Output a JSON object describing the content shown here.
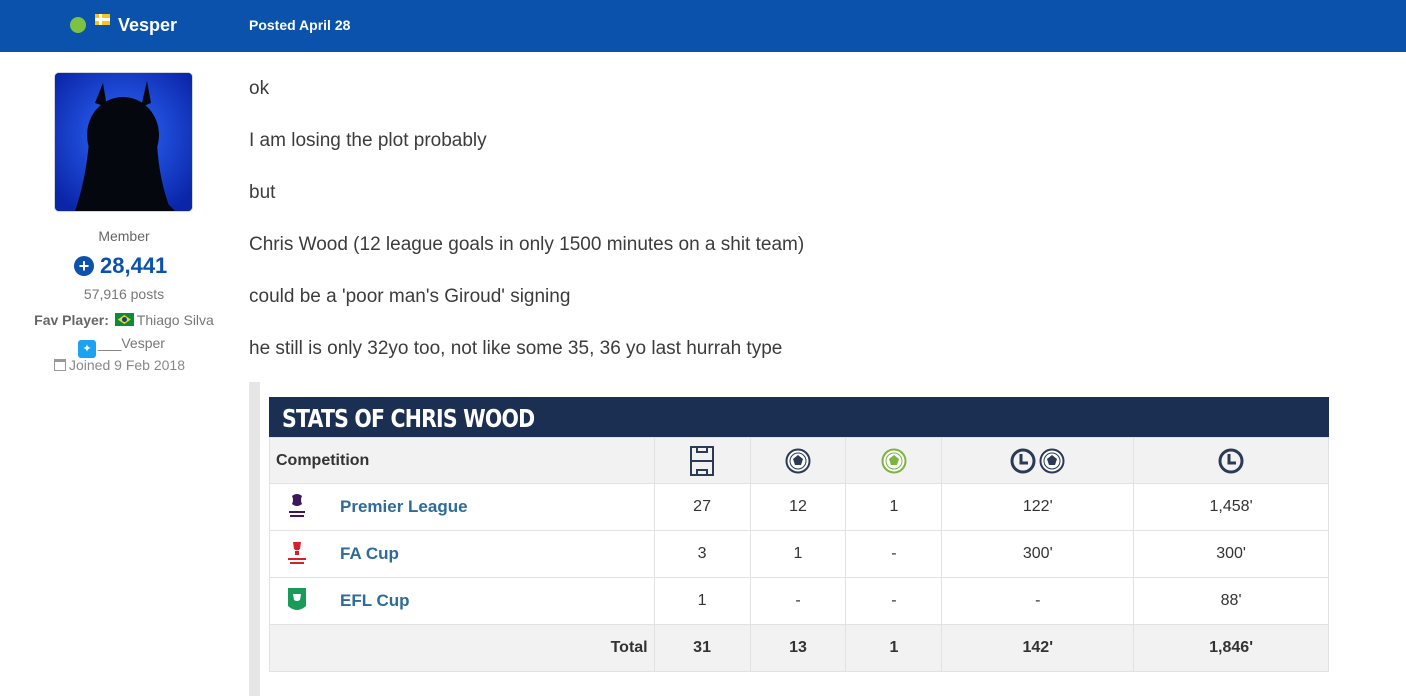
{
  "header": {
    "username": "Vesper",
    "posted": "Posted April 28"
  },
  "author": {
    "rank": "Member",
    "reputation": "28,441",
    "posts": "57,916 posts",
    "fav_label": "Fav Player:",
    "fav_player": "Thiago Silva",
    "twitter": "___Vesper",
    "joined": "Joined 9 Feb 2018"
  },
  "post": {
    "lines": [
      "ok",
      "I am losing the plot probably",
      "but",
      "Chris Wood (12 league goals in only 1500 minutes on a shit team)",
      "could be a 'poor man's Giroud' signing",
      "he still is only 32yo too, not like some 35, 36 yo last hurrah type"
    ]
  },
  "stats": {
    "title": "STATS OF CHRIS WOOD",
    "competition_header": "Competition",
    "column_icons": [
      "pitch-icon",
      "ball-icon",
      "assist-ball-icon",
      "minutes-per-goal-icon",
      "minutes-icon"
    ],
    "rows": [
      {
        "competition": "Premier League",
        "logo": "premier-league-logo",
        "apps": "27",
        "goals": "12",
        "assists": "1",
        "mins_per_goal": "122'",
        "minutes": "1,458'"
      },
      {
        "competition": "FA Cup",
        "logo": "fa-cup-logo",
        "apps": "3",
        "goals": "1",
        "assists": "-",
        "mins_per_goal": "300'",
        "minutes": "300'"
      },
      {
        "competition": "EFL Cup",
        "logo": "efl-cup-logo",
        "apps": "1",
        "goals": "-",
        "assists": "-",
        "mins_per_goal": "-",
        "minutes": "88'"
      }
    ],
    "total": {
      "label": "Total",
      "apps": "31",
      "goals": "13",
      "assists": "1",
      "mins_per_goal": "142'",
      "minutes": "1,846'"
    }
  },
  "colors": {
    "header_bg": "#0b52ad",
    "online": "#7dc243",
    "stats_header_bg": "#1b2f52",
    "link": "#2d6b9a"
  }
}
